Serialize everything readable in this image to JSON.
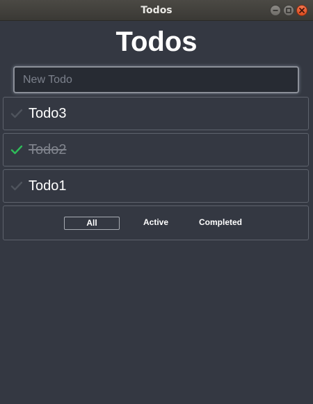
{
  "window": {
    "title": "Todos"
  },
  "app": {
    "heading": "Todos",
    "new_todo": {
      "placeholder": "New Todo",
      "value": ""
    },
    "todos": [
      {
        "label": "Todo3",
        "completed": false
      },
      {
        "label": "Todo2",
        "completed": true
      },
      {
        "label": "Todo1",
        "completed": false
      }
    ],
    "filters": {
      "items": [
        {
          "label": "All",
          "selected": true
        },
        {
          "label": "Active",
          "selected": false
        },
        {
          "label": "Completed",
          "selected": false
        }
      ]
    }
  },
  "colors": {
    "background": "#343842",
    "check_done": "#2ebd59",
    "check_pending": "#4f545d",
    "close_button": "#e8562a"
  },
  "icons": {
    "minimize": "minimize-icon",
    "maximize": "maximize-icon",
    "close": "close-icon",
    "check": "check-icon"
  }
}
